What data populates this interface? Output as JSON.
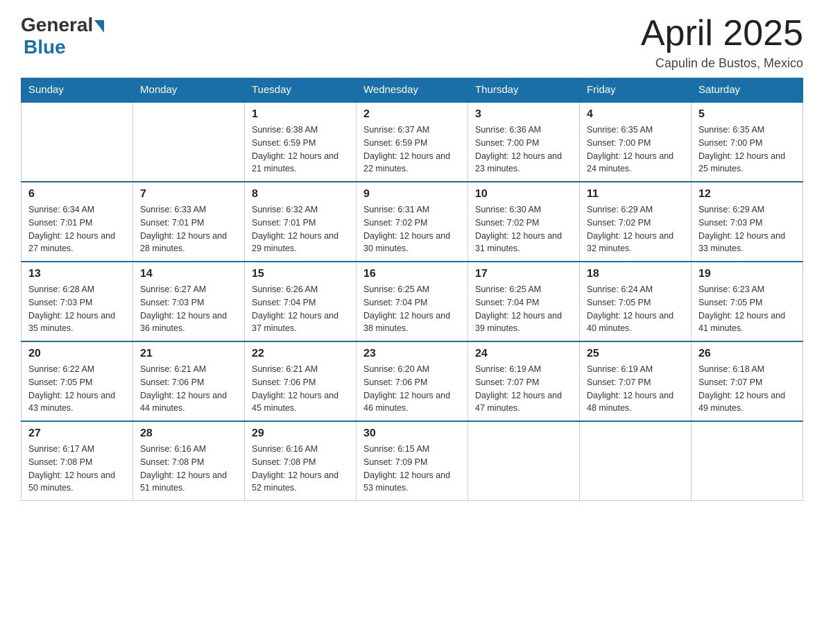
{
  "header": {
    "logo_general": "General",
    "logo_blue": "Blue",
    "month_title": "April 2025",
    "location": "Capulin de Bustos, Mexico"
  },
  "days_of_week": [
    "Sunday",
    "Monday",
    "Tuesday",
    "Wednesday",
    "Thursday",
    "Friday",
    "Saturday"
  ],
  "weeks": [
    [
      {
        "day": "",
        "sunrise": "",
        "sunset": "",
        "daylight": ""
      },
      {
        "day": "",
        "sunrise": "",
        "sunset": "",
        "daylight": ""
      },
      {
        "day": "1",
        "sunrise": "Sunrise: 6:38 AM",
        "sunset": "Sunset: 6:59 PM",
        "daylight": "Daylight: 12 hours and 21 minutes."
      },
      {
        "day": "2",
        "sunrise": "Sunrise: 6:37 AM",
        "sunset": "Sunset: 6:59 PM",
        "daylight": "Daylight: 12 hours and 22 minutes."
      },
      {
        "day": "3",
        "sunrise": "Sunrise: 6:36 AM",
        "sunset": "Sunset: 7:00 PM",
        "daylight": "Daylight: 12 hours and 23 minutes."
      },
      {
        "day": "4",
        "sunrise": "Sunrise: 6:35 AM",
        "sunset": "Sunset: 7:00 PM",
        "daylight": "Daylight: 12 hours and 24 minutes."
      },
      {
        "day": "5",
        "sunrise": "Sunrise: 6:35 AM",
        "sunset": "Sunset: 7:00 PM",
        "daylight": "Daylight: 12 hours and 25 minutes."
      }
    ],
    [
      {
        "day": "6",
        "sunrise": "Sunrise: 6:34 AM",
        "sunset": "Sunset: 7:01 PM",
        "daylight": "Daylight: 12 hours and 27 minutes."
      },
      {
        "day": "7",
        "sunrise": "Sunrise: 6:33 AM",
        "sunset": "Sunset: 7:01 PM",
        "daylight": "Daylight: 12 hours and 28 minutes."
      },
      {
        "day": "8",
        "sunrise": "Sunrise: 6:32 AM",
        "sunset": "Sunset: 7:01 PM",
        "daylight": "Daylight: 12 hours and 29 minutes."
      },
      {
        "day": "9",
        "sunrise": "Sunrise: 6:31 AM",
        "sunset": "Sunset: 7:02 PM",
        "daylight": "Daylight: 12 hours and 30 minutes."
      },
      {
        "day": "10",
        "sunrise": "Sunrise: 6:30 AM",
        "sunset": "Sunset: 7:02 PM",
        "daylight": "Daylight: 12 hours and 31 minutes."
      },
      {
        "day": "11",
        "sunrise": "Sunrise: 6:29 AM",
        "sunset": "Sunset: 7:02 PM",
        "daylight": "Daylight: 12 hours and 32 minutes."
      },
      {
        "day": "12",
        "sunrise": "Sunrise: 6:29 AM",
        "sunset": "Sunset: 7:03 PM",
        "daylight": "Daylight: 12 hours and 33 minutes."
      }
    ],
    [
      {
        "day": "13",
        "sunrise": "Sunrise: 6:28 AM",
        "sunset": "Sunset: 7:03 PM",
        "daylight": "Daylight: 12 hours and 35 minutes."
      },
      {
        "day": "14",
        "sunrise": "Sunrise: 6:27 AM",
        "sunset": "Sunset: 7:03 PM",
        "daylight": "Daylight: 12 hours and 36 minutes."
      },
      {
        "day": "15",
        "sunrise": "Sunrise: 6:26 AM",
        "sunset": "Sunset: 7:04 PM",
        "daylight": "Daylight: 12 hours and 37 minutes."
      },
      {
        "day": "16",
        "sunrise": "Sunrise: 6:25 AM",
        "sunset": "Sunset: 7:04 PM",
        "daylight": "Daylight: 12 hours and 38 minutes."
      },
      {
        "day": "17",
        "sunrise": "Sunrise: 6:25 AM",
        "sunset": "Sunset: 7:04 PM",
        "daylight": "Daylight: 12 hours and 39 minutes."
      },
      {
        "day": "18",
        "sunrise": "Sunrise: 6:24 AM",
        "sunset": "Sunset: 7:05 PM",
        "daylight": "Daylight: 12 hours and 40 minutes."
      },
      {
        "day": "19",
        "sunrise": "Sunrise: 6:23 AM",
        "sunset": "Sunset: 7:05 PM",
        "daylight": "Daylight: 12 hours and 41 minutes."
      }
    ],
    [
      {
        "day": "20",
        "sunrise": "Sunrise: 6:22 AM",
        "sunset": "Sunset: 7:05 PM",
        "daylight": "Daylight: 12 hours and 43 minutes."
      },
      {
        "day": "21",
        "sunrise": "Sunrise: 6:21 AM",
        "sunset": "Sunset: 7:06 PM",
        "daylight": "Daylight: 12 hours and 44 minutes."
      },
      {
        "day": "22",
        "sunrise": "Sunrise: 6:21 AM",
        "sunset": "Sunset: 7:06 PM",
        "daylight": "Daylight: 12 hours and 45 minutes."
      },
      {
        "day": "23",
        "sunrise": "Sunrise: 6:20 AM",
        "sunset": "Sunset: 7:06 PM",
        "daylight": "Daylight: 12 hours and 46 minutes."
      },
      {
        "day": "24",
        "sunrise": "Sunrise: 6:19 AM",
        "sunset": "Sunset: 7:07 PM",
        "daylight": "Daylight: 12 hours and 47 minutes."
      },
      {
        "day": "25",
        "sunrise": "Sunrise: 6:19 AM",
        "sunset": "Sunset: 7:07 PM",
        "daylight": "Daylight: 12 hours and 48 minutes."
      },
      {
        "day": "26",
        "sunrise": "Sunrise: 6:18 AM",
        "sunset": "Sunset: 7:07 PM",
        "daylight": "Daylight: 12 hours and 49 minutes."
      }
    ],
    [
      {
        "day": "27",
        "sunrise": "Sunrise: 6:17 AM",
        "sunset": "Sunset: 7:08 PM",
        "daylight": "Daylight: 12 hours and 50 minutes."
      },
      {
        "day": "28",
        "sunrise": "Sunrise: 6:16 AM",
        "sunset": "Sunset: 7:08 PM",
        "daylight": "Daylight: 12 hours and 51 minutes."
      },
      {
        "day": "29",
        "sunrise": "Sunrise: 6:16 AM",
        "sunset": "Sunset: 7:08 PM",
        "daylight": "Daylight: 12 hours and 52 minutes."
      },
      {
        "day": "30",
        "sunrise": "Sunrise: 6:15 AM",
        "sunset": "Sunset: 7:09 PM",
        "daylight": "Daylight: 12 hours and 53 minutes."
      },
      {
        "day": "",
        "sunrise": "",
        "sunset": "",
        "daylight": ""
      },
      {
        "day": "",
        "sunrise": "",
        "sunset": "",
        "daylight": ""
      },
      {
        "day": "",
        "sunrise": "",
        "sunset": "",
        "daylight": ""
      }
    ]
  ]
}
